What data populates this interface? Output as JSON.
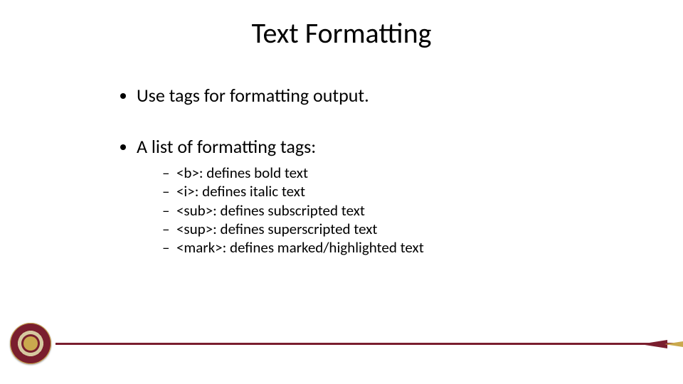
{
  "title": "Text Formatting",
  "bullets": {
    "b1": "Use tags for formatting output.",
    "b2": "A list of formatting tags:",
    "sub": {
      "s1": "<b>:  defines bold text",
      "s2": "<i>:  defines italic text",
      "s3": "<sub>:  defines subscripted text",
      "s4": "<sup>: defines superscripted text",
      "s5": "<mark>: defines marked/highlighted text"
    }
  }
}
